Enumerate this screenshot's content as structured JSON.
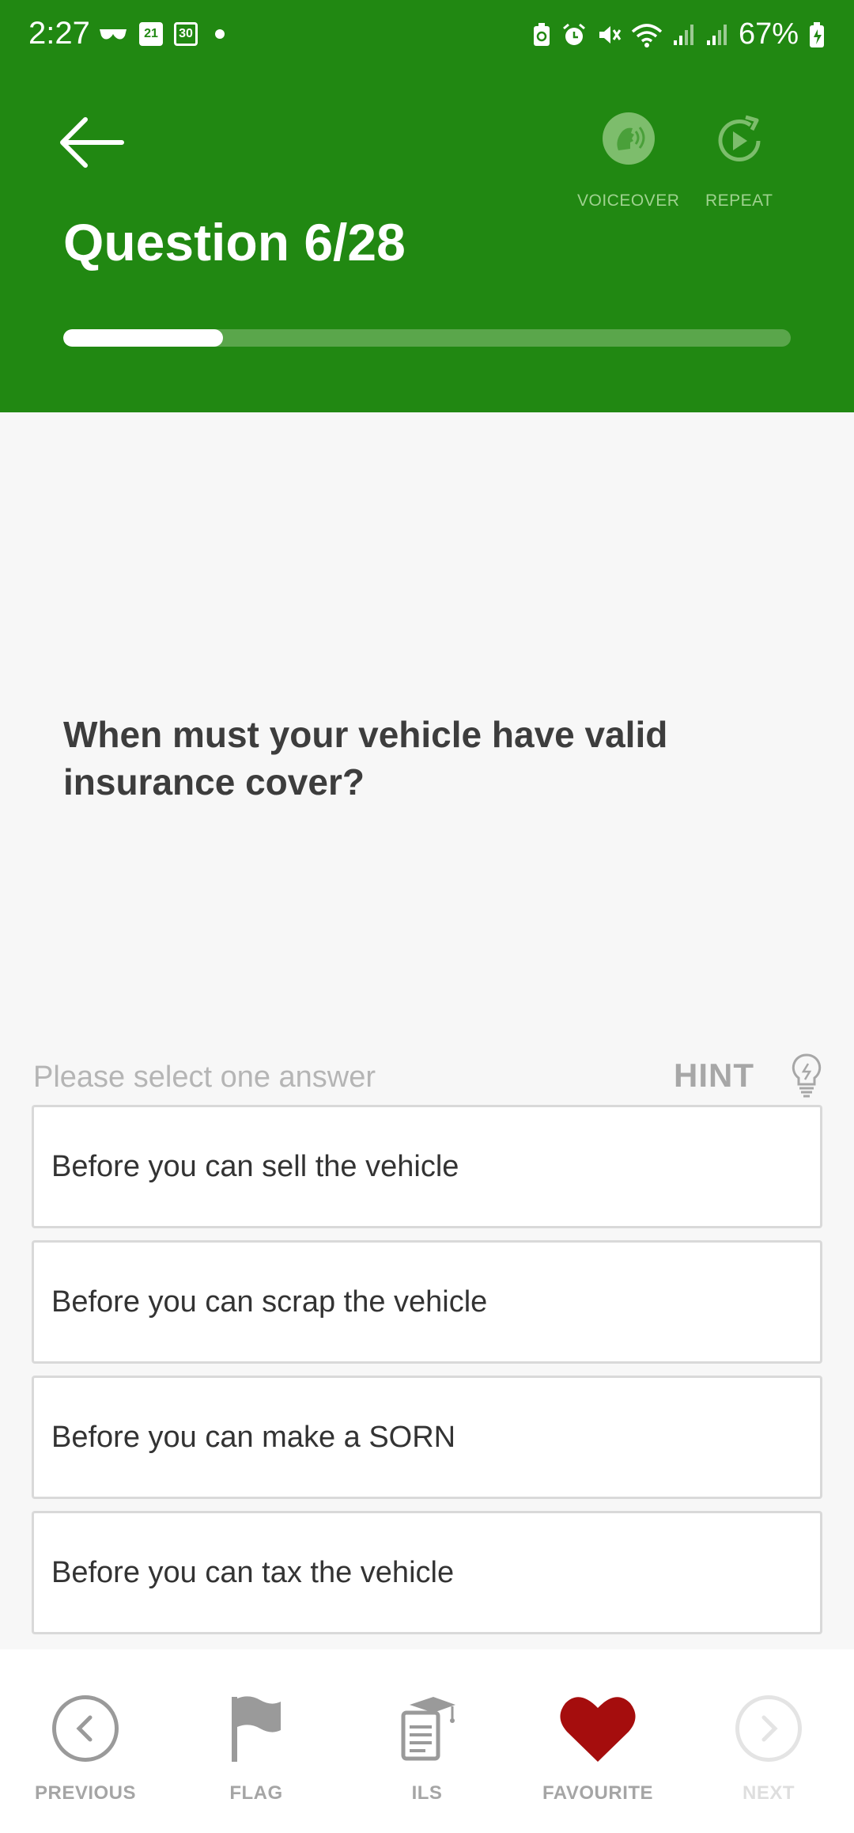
{
  "status_bar": {
    "time": "2:27",
    "calendar_1": "21",
    "calendar_2": "30",
    "battery_percent": "67%"
  },
  "header": {
    "title": "Question 6/28",
    "voiceover_label": "VOICEOVER",
    "repeat_label": "REPEAT",
    "progress": 0.22
  },
  "question": {
    "text": "When must your vehicle have valid insurance cover?",
    "instruction": "Please select one answer",
    "hint_label": "HINT"
  },
  "answers": [
    "Before you can sell the vehicle",
    "Before you can scrap the vehicle",
    "Before you can make a SORN",
    "Before you can tax the vehicle"
  ],
  "bottom_nav": {
    "previous": "PREVIOUS",
    "flag": "FLAG",
    "ils": "ILS",
    "favourite": "FAVOURITE",
    "next": "NEXT"
  },
  "colors": {
    "brand_green": "#218812",
    "favourite_red": "#a50d0d"
  }
}
